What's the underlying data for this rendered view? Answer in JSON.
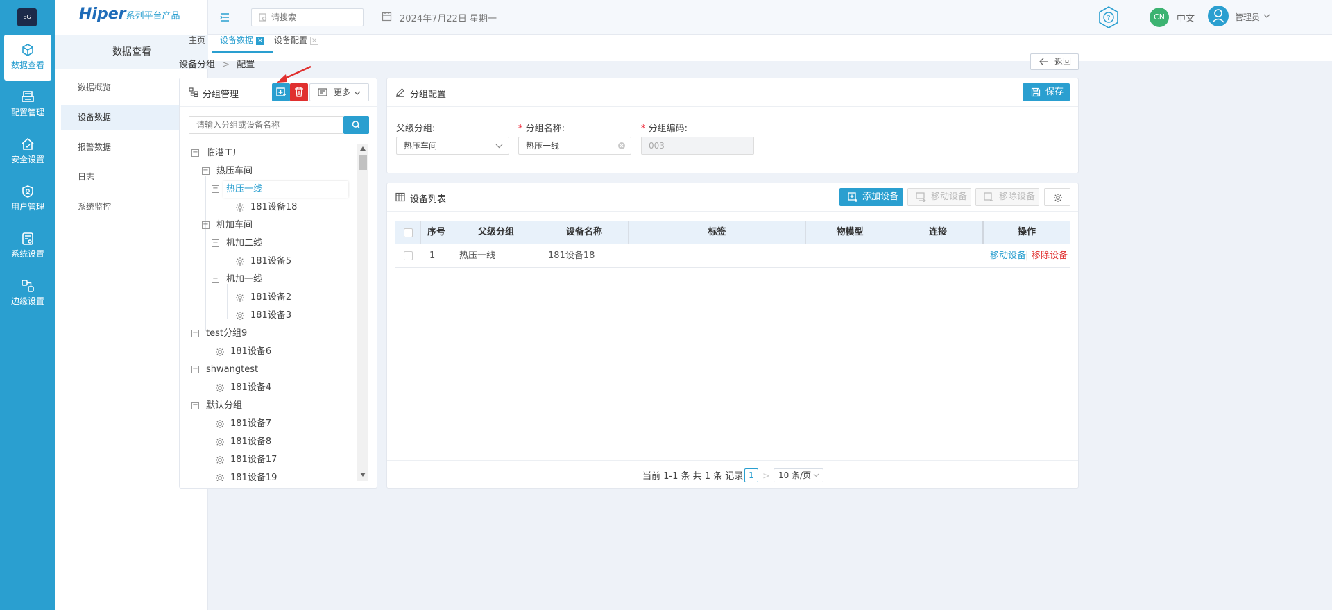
{
  "rail": {
    "logo": "EG",
    "items": [
      {
        "label": "数据查看",
        "icon": "box-icon"
      },
      {
        "label": "配置管理",
        "icon": "printer-config-icon"
      },
      {
        "label": "安全设置",
        "icon": "house-shield-icon"
      },
      {
        "label": "用户管理",
        "icon": "user-shield-icon"
      },
      {
        "label": "系统设置",
        "icon": "system-settings-icon"
      },
      {
        "label": "边缘设置",
        "icon": "edge-network-icon"
      }
    ]
  },
  "brand": {
    "name": "Hiper",
    "suffix": "系列平台产品"
  },
  "sidebar": {
    "title": "数据查看",
    "items": [
      "数据概览",
      "设备数据",
      "报警数据",
      "日志",
      "系统监控"
    ]
  },
  "topbar": {
    "search_placeholder": "请搜索",
    "date": "2024年7月22日 星期一",
    "lang_badge": "CN",
    "lang": "中文",
    "user": "管理员"
  },
  "tabs": [
    {
      "label": "主页"
    },
    {
      "label": "设备数据",
      "close": "×"
    },
    {
      "label": "设备配置",
      "close": "×"
    }
  ],
  "breadcrumb": {
    "a": "设备分组",
    "sep": ">",
    "b": "配置"
  },
  "back_label": "返回",
  "group_panel": {
    "title": "分组管理",
    "more_label": "更多",
    "search_placeholder": "请输入分组或设备名称",
    "tree": [
      {
        "label": "临港工厂",
        "toggle": "−"
      },
      {
        "label": "热压车间",
        "toggle": "−"
      },
      {
        "label": "热压一线",
        "toggle": "−"
      },
      {
        "label": "181设备18"
      },
      {
        "label": "机加车间",
        "toggle": "−"
      },
      {
        "label": "机加二线",
        "toggle": "−"
      },
      {
        "label": "181设备5"
      },
      {
        "label": "机加一线",
        "toggle": "−"
      },
      {
        "label": "181设备2"
      },
      {
        "label": "181设备3"
      },
      {
        "label": "test分组9",
        "toggle": "−"
      },
      {
        "label": "181设备6"
      },
      {
        "label": "shwangtest",
        "toggle": "−"
      },
      {
        "label": "181设备4"
      },
      {
        "label": "默认分组",
        "toggle": "−"
      },
      {
        "label": "181设备7"
      },
      {
        "label": "181设备8"
      },
      {
        "label": "181设备17"
      },
      {
        "label": "181设备19"
      }
    ]
  },
  "config_panel": {
    "title": "分组配置",
    "save_label": "保存",
    "parent_label": "父级分组:",
    "parent_value": "热压车间",
    "name_label": "分组名称:",
    "name_value": "热压一线",
    "code_label": "分组编码:",
    "code_value": "003",
    "required_mark": "*"
  },
  "device_panel": {
    "title": "设备列表",
    "add_label": "添加设备",
    "move_label": "移动设备",
    "remove_label": "移除设备",
    "columns": [
      "序号",
      "父级分组",
      "设备名称",
      "标签",
      "物模型",
      "连接",
      "操作"
    ],
    "rows": [
      {
        "index": "1",
        "parent": "热压一线",
        "name": "181设备18",
        "tag": "",
        "model": "",
        "conn": "",
        "action_move": "移动设备",
        "action_sep": "|",
        "action_remove": "移除设备"
      }
    ]
  },
  "pagination": {
    "summary": "当前 1-1 条 共 1 条 记录",
    "prev": "<",
    "page": "1",
    "next": ">",
    "page_size": "10 条/页"
  },
  "colors": {
    "accent": "#2a9fd0",
    "danger": "#e0302f",
    "brand": "#1e6bb8"
  }
}
